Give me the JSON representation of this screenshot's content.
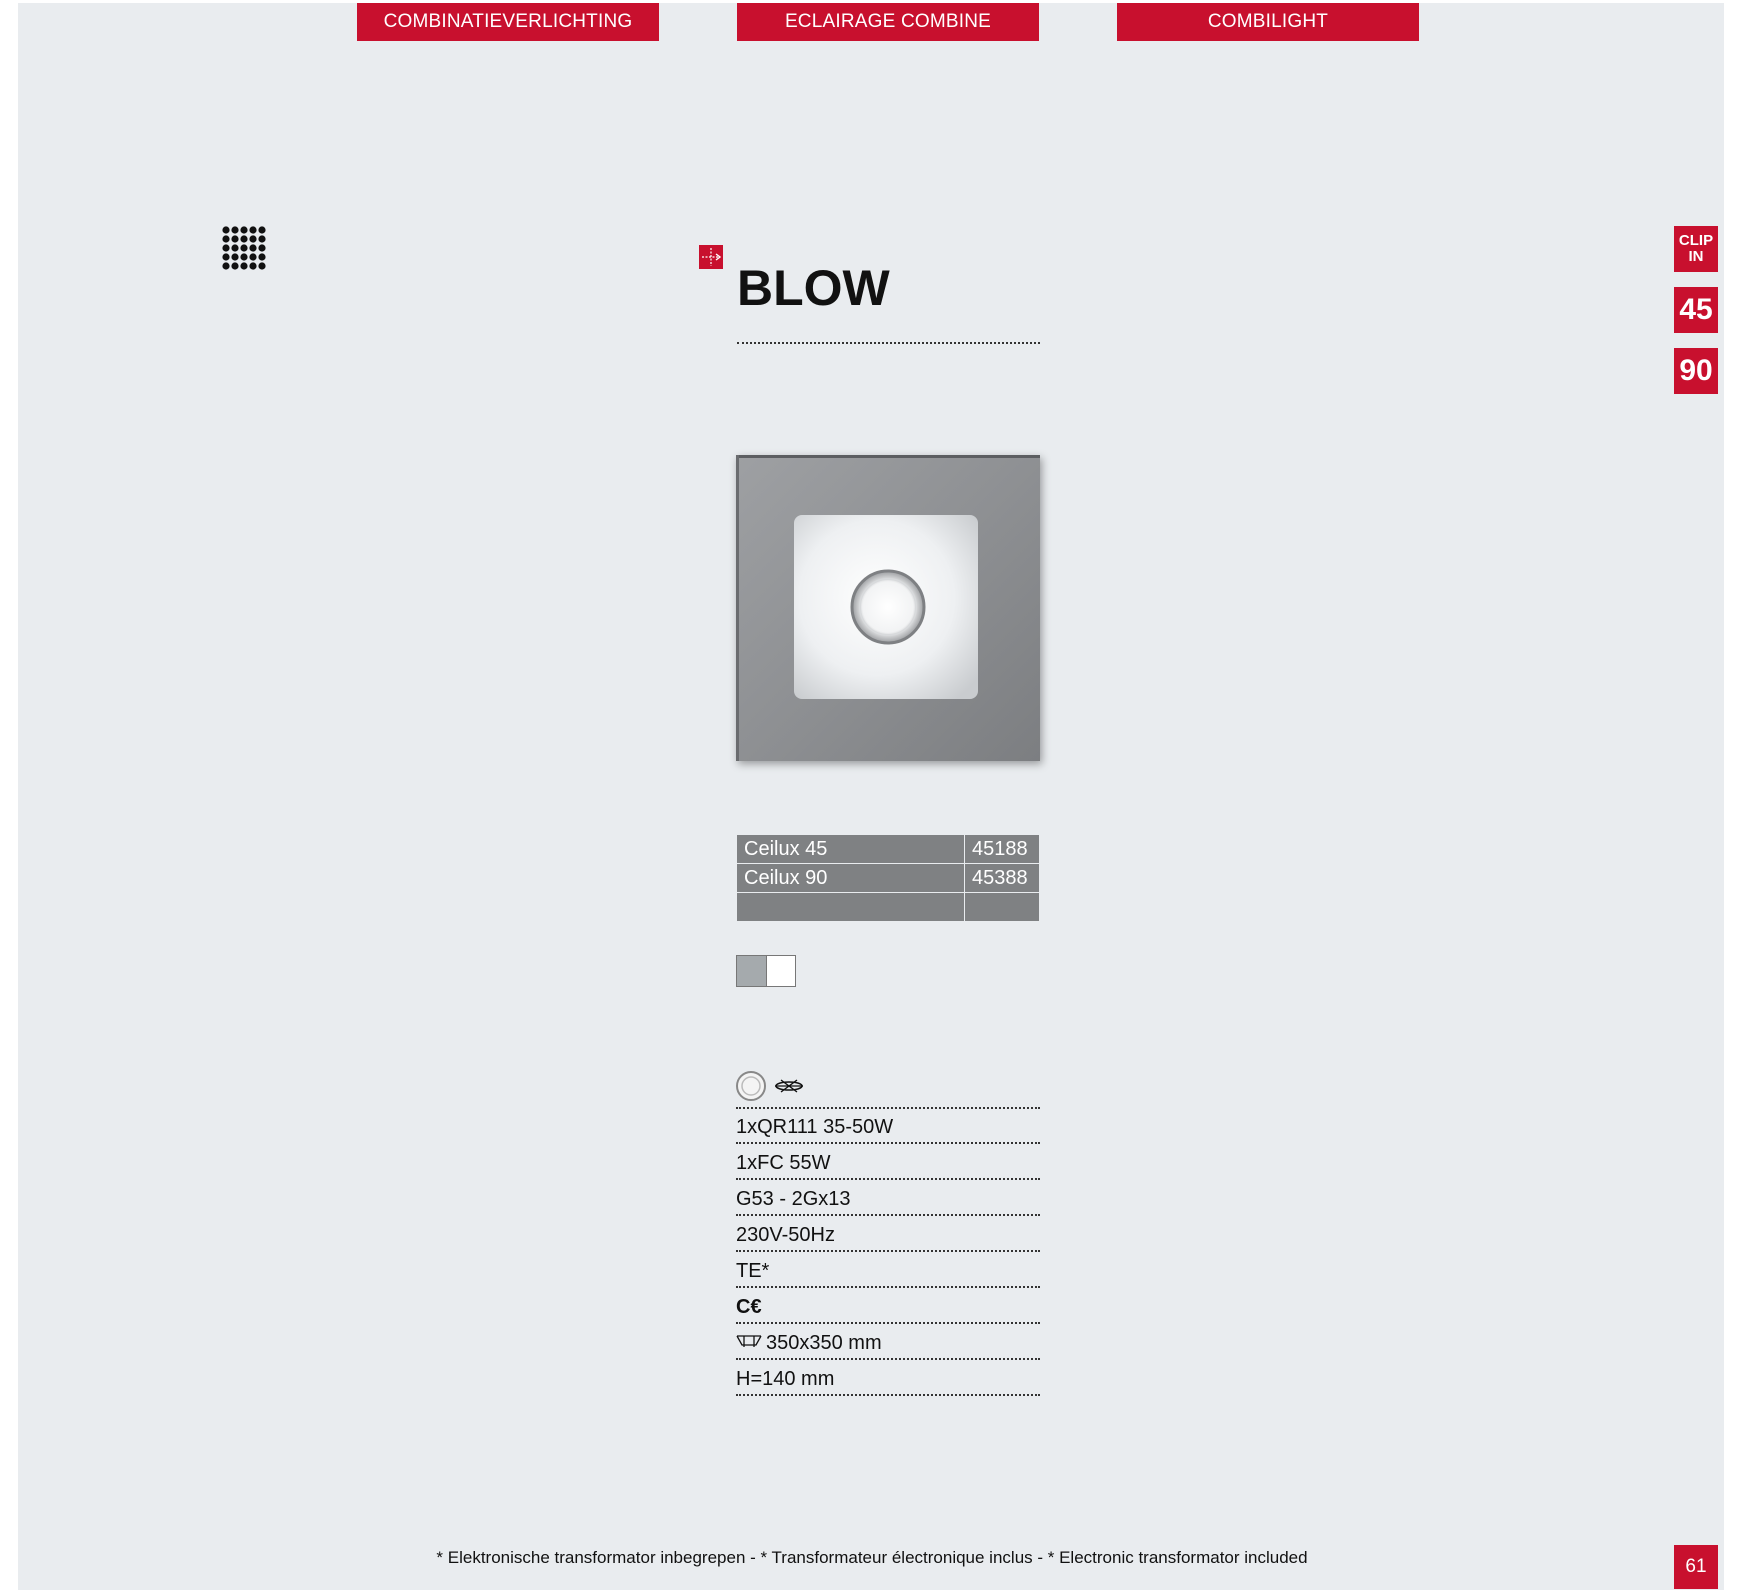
{
  "header": {
    "tabs": [
      {
        "label": "COMBINATIEVERLICHTING"
      },
      {
        "label": "ECLAIRAGE COMBINE"
      },
      {
        "label": "COMBILIGHT"
      }
    ]
  },
  "icons": {
    "pattern": "dot-grid-icon",
    "category": "recessed-arrows-icon",
    "lamp_round": "round-lamp-icon",
    "lamp_tube": "fluorescent-lamp-icon",
    "ce": "ce-mark-icon",
    "cutout": "ceiling-cutout-icon"
  },
  "product": {
    "title": "BLOW",
    "image_alt": "square recessed ceiling luminaire"
  },
  "side_badges": {
    "clip_line1": "CLIP",
    "clip_line2": "IN",
    "b45": "45",
    "b90": "90"
  },
  "codes": [
    {
      "name": "Ceilux 45",
      "code": "45188"
    },
    {
      "name": "Ceilux 90",
      "code": "45388"
    },
    {
      "name": "",
      "code": ""
    }
  ],
  "finishes": [
    "grey",
    "white"
  ],
  "specs": {
    "lamp1": "1xQR111 35-50W",
    "lamp2": "1xFC 55W",
    "socket": "G53 - 2Gx13",
    "voltage": "230V-50Hz",
    "transformer": "TE*",
    "ce": "C€",
    "cutout": "350x350 mm",
    "height": "H=140 mm"
  },
  "footnote": "* Elektronische transformator inbegrepen - * Transformateur électronique inclus - * Electronic transformator included",
  "page_number": "61",
  "colors": {
    "accent": "#c8102e",
    "page_bg": "#e9ecef",
    "table_bg": "#7f8183"
  }
}
